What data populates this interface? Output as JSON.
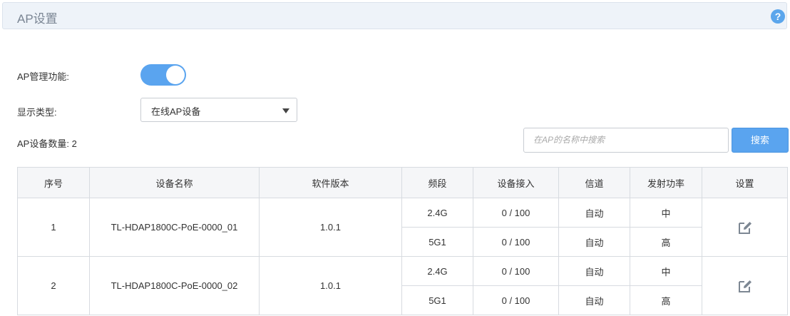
{
  "header": {
    "title": "AP设置",
    "help_icon": "help-icon"
  },
  "form": {
    "ap_management_label": "AP管理功能:",
    "ap_management_enabled": true,
    "display_type_label": "显示类型:",
    "display_type_value": "在线AP设备",
    "ap_count_label": "AP设备数量: 2"
  },
  "search": {
    "placeholder": "在AP的名称中搜索",
    "button_label": "搜索"
  },
  "table": {
    "headers": [
      "序号",
      "设备名称",
      "软件版本",
      "频段",
      "设备接入",
      "信道",
      "发射功率",
      "设置"
    ],
    "devices": [
      {
        "index": "1",
        "name": "TL-HDAP1800C-PoE-0000_01",
        "version": "1.0.1",
        "bands": [
          {
            "band": "2.4G",
            "access": "0 / 100",
            "channel": "自动",
            "power": "中"
          },
          {
            "band": "5G1",
            "access": "0 / 100",
            "channel": "自动",
            "power": "高"
          }
        ]
      },
      {
        "index": "2",
        "name": "TL-HDAP1800C-PoE-0000_02",
        "version": "1.0.1",
        "bands": [
          {
            "band": "2.4G",
            "access": "0 / 100",
            "channel": "自动",
            "power": "中"
          },
          {
            "band": "5G1",
            "access": "0 / 100",
            "channel": "自动",
            "power": "高"
          }
        ]
      }
    ]
  },
  "colors": {
    "accent": "#5aa4ef",
    "header_bg": "#eef3f9",
    "border": "#d7dbe0"
  }
}
